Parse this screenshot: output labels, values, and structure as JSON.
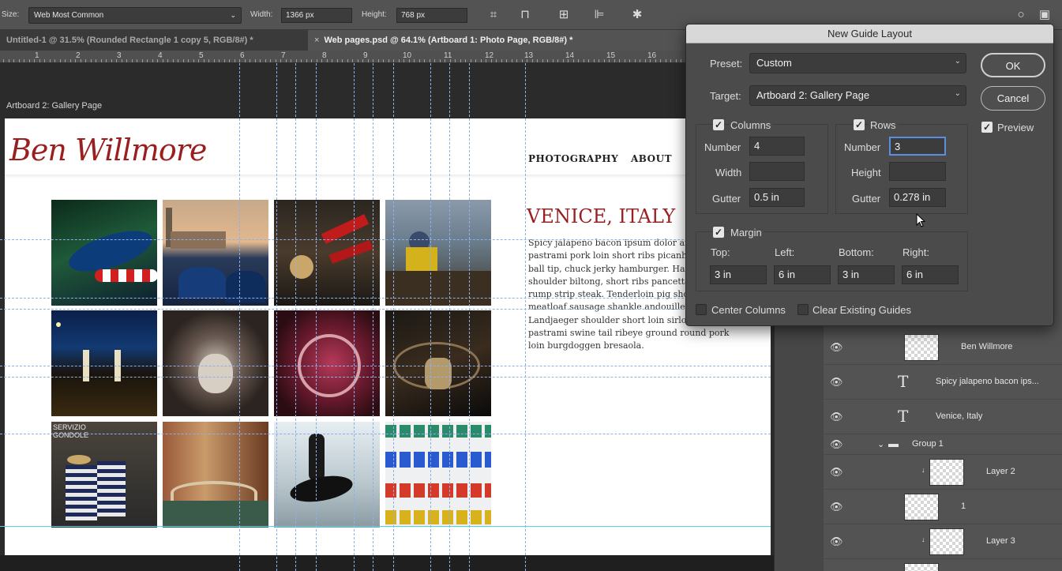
{
  "options_bar": {
    "size_label": "Size:",
    "size_value": "Web Most Common",
    "width_label": "Width:",
    "width_value": "1366 px",
    "height_label": "Height:",
    "height_value": "768 px"
  },
  "tabs": [
    {
      "label": "Untitled-1 @ 31.5% (Rounded Rectangle 1 copy 5, RGB/8#) *"
    },
    {
      "label": "Web pages.psd @ 64.1% (Artboard 1: Photo Page, RGB/8#) *"
    }
  ],
  "ruler": {
    "numbers": [
      "1",
      "2",
      "3",
      "4",
      "5",
      "6",
      "7",
      "8",
      "9",
      "10",
      "11",
      "12",
      "13",
      "14",
      "15",
      "16"
    ]
  },
  "artboard_label": "Artboard 2: Gallery Page",
  "site": {
    "logo": "Ben Willmore",
    "nav": [
      "PHOTOGRAPHY",
      "ABOUT"
    ],
    "heading": "VENICE, ITALY",
    "body": "Spicy jalapeno bacon ipsum dolor amet cow pastrami pork loin short ribs picanha cupim ball tip, chuck jerky hamburger. Hamburger shoulder biltong, short ribs pancetta kielbasa rump strip steak. Tenderloin pig short loin, meatloaf sausage shankle andouille. Landjaeger shoulder short loin sirloin pastrami swine tail ribeye ground round pork loin burgdoggen bresaola.",
    "sign_text": "SERVIZIO GONDOLE"
  },
  "dialog": {
    "title": "New Guide Layout",
    "preset_label": "Preset:",
    "preset_value": "Custom",
    "target_label": "Target:",
    "target_value": "Artboard 2: Gallery Page",
    "ok_label": "OK",
    "cancel_label": "Cancel",
    "preview_label": "Preview",
    "columns": {
      "label": "Columns",
      "number_label": "Number",
      "number_value": "4",
      "width_label": "Width",
      "width_value": "",
      "gutter_label": "Gutter",
      "gutter_value": "0.5 in"
    },
    "rows": {
      "label": "Rows",
      "number_label": "Number",
      "number_value": "3",
      "height_label": "Height",
      "height_value": "",
      "gutter_label": "Gutter",
      "gutter_value": "0.278 in"
    },
    "margin": {
      "label": "Margin",
      "top_label": "Top:",
      "left_label": "Left:",
      "bottom_label": "Bottom:",
      "right_label": "Right:",
      "top_value": "3 in",
      "left_value": "6 in",
      "bottom_value": "3 in",
      "right_value": "6 in"
    },
    "center_columns_label": "Center Columns",
    "clear_guides_label": "Clear Existing Guides"
  },
  "layers": [
    {
      "name": "Ben Willmore",
      "kind": "smart-object"
    },
    {
      "name": "Spicy jalapeno bacon ips...",
      "kind": "text"
    },
    {
      "name": "Venice, Italy",
      "kind": "text"
    },
    {
      "name": "Group 1",
      "kind": "group"
    },
    {
      "name": "Layer 2",
      "kind": "pixel"
    },
    {
      "name": "1",
      "kind": "pixel"
    },
    {
      "name": "Layer 3",
      "kind": "pixel"
    }
  ],
  "colors": {
    "brand_red": "#9a1f1f",
    "guide": "#8fb0e6",
    "smart_guide": "#53d4e6",
    "dialog_bg": "#4b4b4b"
  }
}
